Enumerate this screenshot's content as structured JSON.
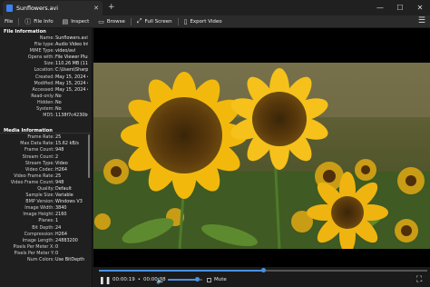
{
  "titlebar": {
    "tab_title": "Sunflowers.avi",
    "close_tab": "✕",
    "new_tab": "+",
    "minimize": "—",
    "maximize": "☐",
    "close": "✕"
  },
  "toolbar": {
    "file": "File",
    "file_info": "File Info",
    "inspect": "Inspect",
    "browse": "Browse",
    "full_screen": "Full Screen",
    "export_video": "Export Video"
  },
  "sidebar": {
    "file_information": {
      "heading": "File Information",
      "rows": [
        {
          "label": "Name:",
          "value": "Sunflowers.avi"
        },
        {
          "label": "File type:",
          "value": "Audio Video Interleave Fil..."
        },
        {
          "label": "MIME Type:",
          "value": "video/avi"
        },
        {
          "label": "Opens with:",
          "value": "File Viewer Plus 5"
        },
        {
          "label": "Size:",
          "value": "110.26 MB (115,618,182 by..."
        },
        {
          "label": "Location:",
          "value": "C:\\Users\\SharpenedProdu..."
        },
        {
          "label": "Created:",
          "value": "May 15, 2024 4:49 PM"
        },
        {
          "label": "Modified:",
          "value": "May 15, 2024 4:49 PM"
        },
        {
          "label": "Accessed:",
          "value": "May 15, 2024 4:49 PM"
        },
        {
          "label": "Read-only:",
          "value": "No"
        },
        {
          "label": "Hidden:",
          "value": "No"
        },
        {
          "label": "System:",
          "value": "No"
        },
        {
          "label": "MD5:",
          "value": "1138f7c4230b0d1fba07..."
        }
      ]
    },
    "media_information": {
      "heading": "Media Information",
      "rows": [
        {
          "label": "Frame Rate:",
          "value": "25"
        },
        {
          "label": "Max Data Rate:",
          "value": "15.62 kB/s"
        },
        {
          "label": "Frame Count:",
          "value": "948"
        },
        {
          "label": "Stream Count:",
          "value": "2"
        },
        {
          "label": "Stream Type:",
          "value": "Video"
        },
        {
          "label": "Video Codec:",
          "value": "H264"
        },
        {
          "label": "Video Frame Rate:",
          "value": "25"
        },
        {
          "label": "Video Frame Count:",
          "value": "948"
        },
        {
          "label": "Quality:",
          "value": "Default"
        },
        {
          "label": "Sample Size:",
          "value": "Variable"
        },
        {
          "label": "BMP Version:",
          "value": "Windows V3"
        },
        {
          "label": "Image Width:",
          "value": "3840"
        },
        {
          "label": "Image Height:",
          "value": "2160"
        },
        {
          "label": "Planes:",
          "value": "1"
        },
        {
          "label": "Bit Depth:",
          "value": "24"
        },
        {
          "label": "Compression:",
          "value": "H264"
        },
        {
          "label": "Image Length:",
          "value": "24883200"
        },
        {
          "label": "Pixels Per Meter X:",
          "value": "0"
        },
        {
          "label": "Pixels Per Meter Y:",
          "value": "0"
        },
        {
          "label": "Num Colors:",
          "value": "Use BitDepth"
        }
      ]
    }
  },
  "player": {
    "progress": 0.5,
    "volume": 0.85,
    "current_time": "00:00:19",
    "total_time": "00:00:38",
    "mute_label": "Mute"
  },
  "colors": {
    "accent": "#4a90e2",
    "background": "#1c1c1c"
  }
}
